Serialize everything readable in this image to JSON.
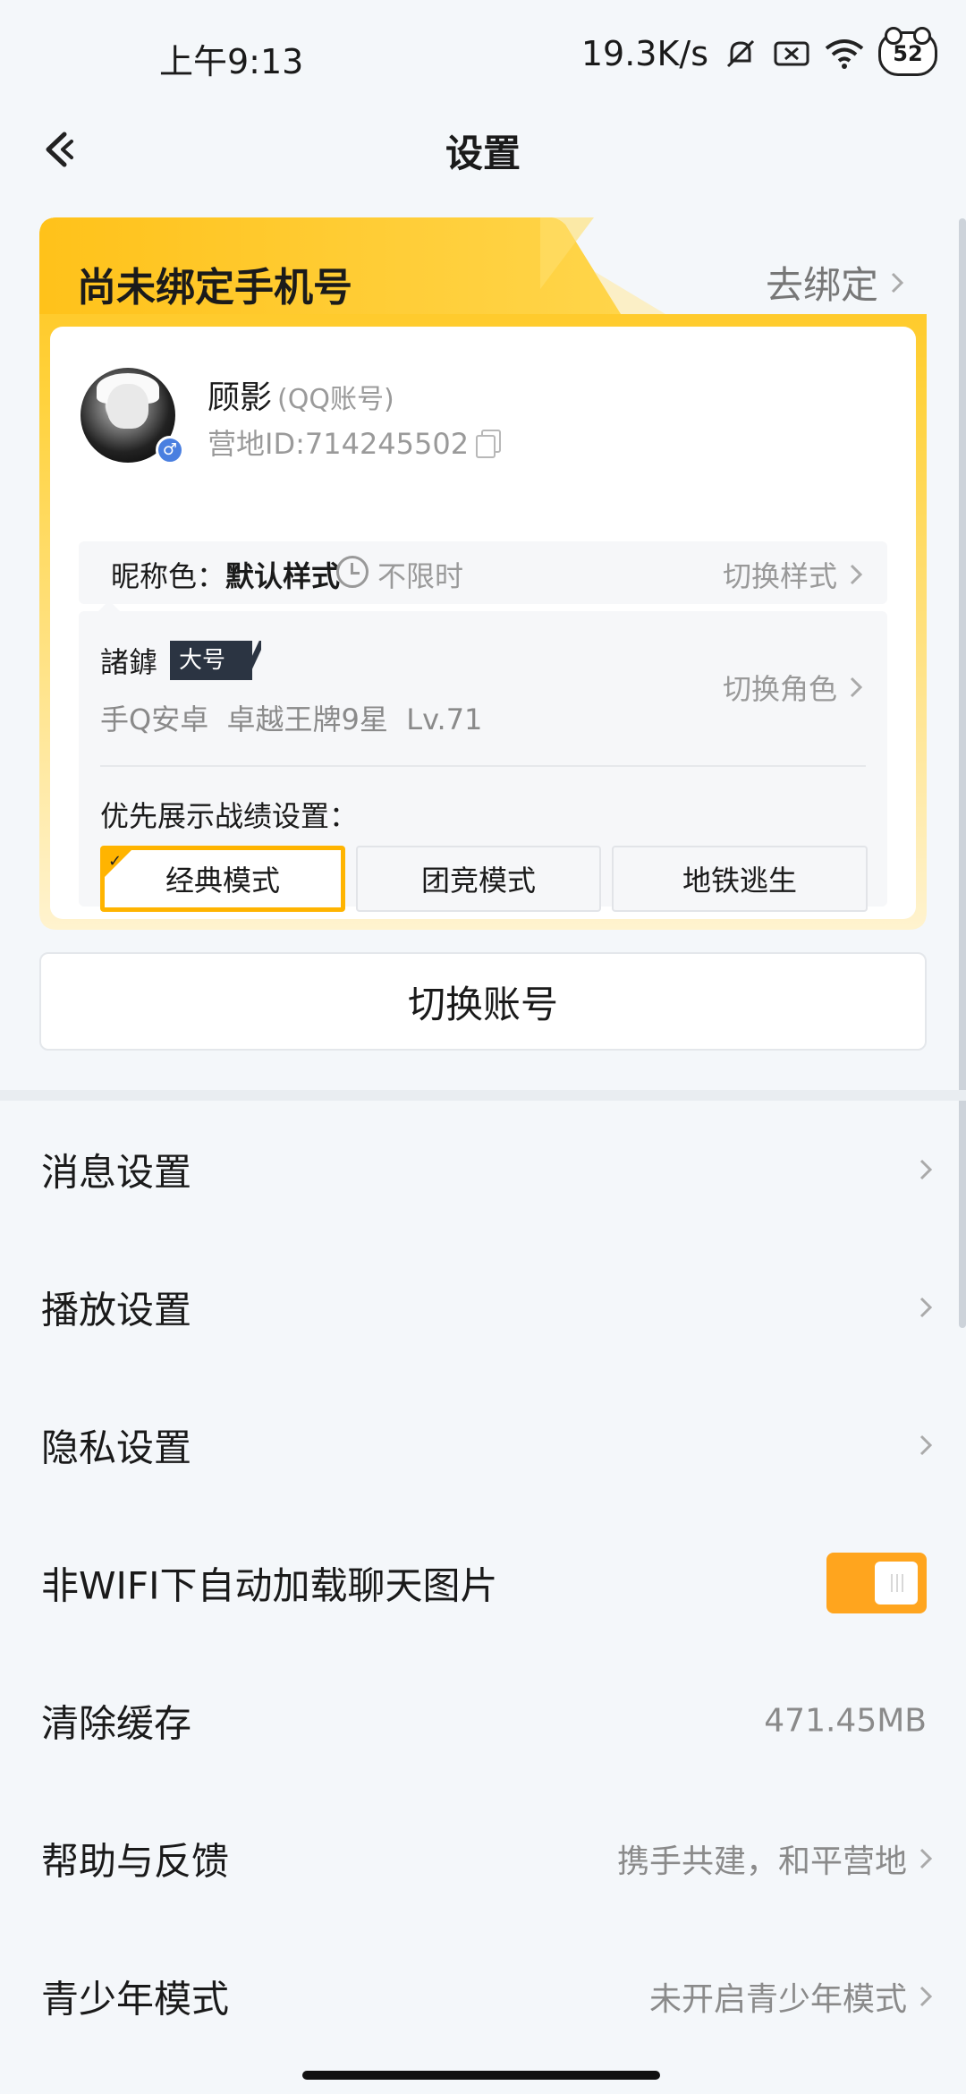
{
  "status_bar": {
    "time": "上午9:13",
    "net_speed": "19.3K/s",
    "battery": "52"
  },
  "header": {
    "title": "设置"
  },
  "bind_card": {
    "title": "尚未绑定手机号",
    "action": "去绑定",
    "user": {
      "name": "顾影",
      "account_type": "(QQ账号)",
      "camp_id": "营地ID:714245502"
    },
    "nickname_color": {
      "label": "昵称色：",
      "value": "默认样式",
      "time": "不限时",
      "switch_label": "切换样式"
    },
    "role": {
      "name": "諸鎼",
      "tag": "大号",
      "sub": "手Q安卓  卓越王牌9星  Lv.71",
      "switch_label": "切换角色"
    },
    "priority": {
      "label": "优先展示战绩设置：",
      "modes": [
        {
          "label": "经典模式",
          "active": true
        },
        {
          "label": "团竞模式",
          "active": false
        },
        {
          "label": "地铁逃生",
          "active": false
        }
      ]
    }
  },
  "switch_account": "切换账号",
  "settings": [
    {
      "label": "消息设置",
      "value": ""
    },
    {
      "label": "播放设置",
      "value": ""
    },
    {
      "label": "隐私设置",
      "value": ""
    },
    {
      "label": "非WIFI下自动加载聊天图片",
      "toggle": true
    },
    {
      "label": "清除缓存",
      "value": "471.45MB"
    },
    {
      "label": "帮助与反馈",
      "value": "携手共建，和平营地"
    },
    {
      "label": "青少年模式",
      "value": "未开启青少年模式"
    }
  ],
  "colors": {
    "accent": "#ffb400",
    "toggle_on": "#ffa51e",
    "card_gradient_top": "#ffc21a",
    "card_gradient_bottom": "#fff3cf"
  },
  "icons": [
    "back-arrow-icon",
    "chevron-right-icon",
    "copy-icon",
    "clock-icon",
    "male-icon",
    "wifi-icon",
    "bell-mute-icon",
    "sim-off-icon"
  ]
}
